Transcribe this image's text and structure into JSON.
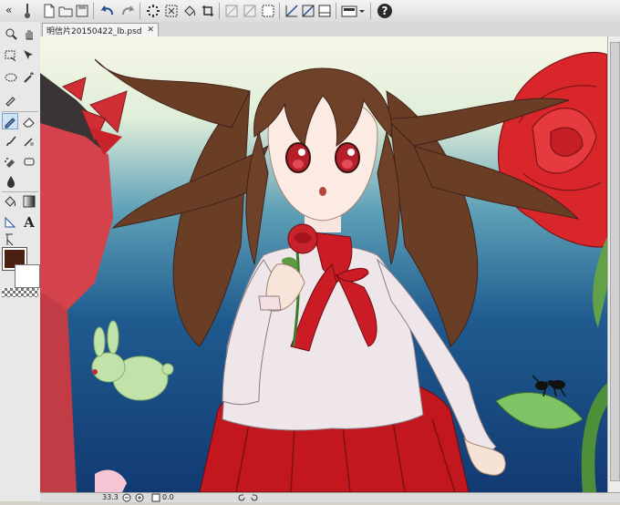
{
  "toolbar": {
    "buttons": [
      "new-icon",
      "open-icon",
      "save-icon",
      "undo-icon",
      "redo-icon",
      "transform-icon",
      "clear-icon",
      "fill-icon",
      "crop-icon",
      "ruler-icon",
      "snap-icon",
      "select-icon",
      "perspective-icon",
      "grid-icon",
      "color-picker-icon",
      "screen-icon",
      "help-icon"
    ]
  },
  "document": {
    "tab_title": "明信片20150422_lb.psd",
    "close_glyph": "✕"
  },
  "palette": {
    "tools": [
      "zoom",
      "hand",
      "lasso-select",
      "move",
      "ellipse-select",
      "magic-wand",
      "eyedropper",
      "pen",
      "eraser",
      "brush",
      "blur",
      "airbrush",
      "smudge",
      "water",
      "fill",
      "gradient",
      "ruler",
      "text",
      "vector"
    ],
    "main_color": "#4a2015",
    "sub_color": "#ffffff"
  },
  "status": {
    "zoom": "33.3",
    "angle": "0.0"
  },
  "colors": {
    "canvas_top": "#f6f7e8",
    "canvas_bottom": "#153d76",
    "hair": "#6a3e25",
    "rose": "#d8262b",
    "skirt": "#c2171f",
    "bunny": "#bfe0a5"
  }
}
